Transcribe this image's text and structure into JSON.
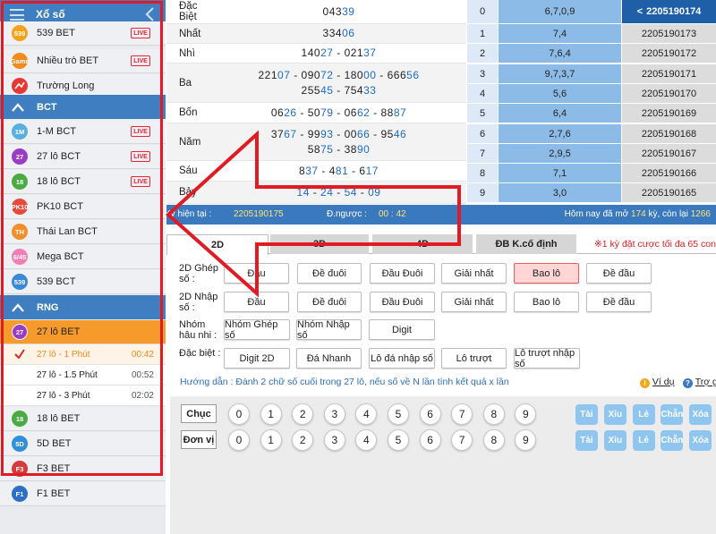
{
  "sidebar": {
    "title": "Xổ số",
    "rows_top": [
      {
        "label": "539 BET",
        "badge": "539",
        "color": "#f4a21a",
        "live": "LIVE"
      },
      {
        "label": "Nhiều trò BET",
        "badge": "Game",
        "color": "#f08a1c",
        "live": "LIVE"
      },
      {
        "label": "Trường Long",
        "badge": "",
        "color": "#e63935",
        "live": ""
      }
    ],
    "section_bct": "BCT",
    "rows_bct": [
      {
        "label": "1-M BCT",
        "badge": "1M",
        "color": "#59b0df",
        "live": "LIVE"
      },
      {
        "label": "27 lô BCT",
        "badge": "27",
        "color": "#9b3cc4",
        "live": "LIVE"
      },
      {
        "label": "18 lô BCT",
        "badge": "18",
        "color": "#4caa43",
        "live": "LIVE"
      },
      {
        "label": "PK10 BCT",
        "badge": "PK10",
        "color": "#e64a3b",
        "live": ""
      },
      {
        "label": "Thái Lan BCT",
        "badge": "TH",
        "color": "#f28e2b",
        "live": ""
      },
      {
        "label": "Mega BCT",
        "badge": "6/45",
        "color": "#ef7fb4",
        "live": ""
      },
      {
        "label": "539 BCT",
        "badge": "539",
        "color": "#3b87d8",
        "live": ""
      }
    ],
    "section_rng": "RNG",
    "active": {
      "label": "27 lô BET",
      "badge": "27",
      "color": "#9b3cc4"
    },
    "subs": [
      {
        "label": "27 lô - 1 Phút",
        "time": "00:42",
        "selected": true
      },
      {
        "label": "27 lô - 1.5 Phút",
        "time": "00:52",
        "selected": false
      },
      {
        "label": "27 lô - 3 Phút",
        "time": "02:02",
        "selected": false
      }
    ],
    "rows_rng": [
      {
        "label": "18 lô BET",
        "badge": "18",
        "color": "#4caa43"
      },
      {
        "label": "5D BET",
        "badge": "5D",
        "color": "#2f8fd8"
      },
      {
        "label": "F3 BET",
        "badge": "F3",
        "color": "#d63b3b"
      },
      {
        "label": "F1 BET",
        "badge": "F1",
        "color": "#2c6fc7"
      }
    ]
  },
  "results": [
    {
      "label": "Đặc Biệt",
      "lines": [
        [
          [
            "043",
            ""
          ],
          [
            "39",
            "b"
          ]
        ]
      ]
    },
    {
      "label": "Nhất",
      "lines": [
        [
          [
            "334",
            ""
          ],
          [
            "06",
            "b"
          ]
        ]
      ]
    },
    {
      "label": "Nhì",
      "lines": [
        [
          [
            "140",
            ""
          ],
          [
            "27",
            "b"
          ],
          [
            " - 021",
            ""
          ],
          [
            "37",
            "b"
          ]
        ]
      ]
    },
    {
      "label": "Ba",
      "lines": [
        [
          [
            "221",
            ""
          ],
          [
            "07",
            "b"
          ],
          [
            " - 090",
            ""
          ],
          [
            "72",
            "b"
          ],
          [
            " - 180",
            ""
          ],
          [
            "00",
            "b"
          ],
          [
            " - 666",
            ""
          ],
          [
            "56",
            "b"
          ]
        ],
        [
          [
            "255",
            ""
          ],
          [
            "45",
            "b"
          ],
          [
            " - 754",
            ""
          ],
          [
            "33",
            "b"
          ]
        ]
      ]
    },
    {
      "label": "Bốn",
      "lines": [
        [
          [
            "06",
            ""
          ],
          [
            "26",
            "b"
          ],
          [
            " - 50",
            ""
          ],
          [
            "79",
            "b"
          ],
          [
            " - 06",
            ""
          ],
          [
            "62",
            "b"
          ],
          [
            " - 88",
            ""
          ],
          [
            "87",
            "b"
          ]
        ]
      ]
    },
    {
      "label": "Năm",
      "lines": [
        [
          [
            "37",
            ""
          ],
          [
            "67",
            "b"
          ],
          [
            " - 99",
            ""
          ],
          [
            "93",
            "b"
          ],
          [
            " - 00",
            ""
          ],
          [
            "66",
            "b"
          ],
          [
            " - 95",
            ""
          ],
          [
            "46",
            "b"
          ]
        ],
        [
          [
            "58",
            ""
          ],
          [
            "75",
            "b"
          ],
          [
            " - 38",
            ""
          ],
          [
            "90",
            "b"
          ]
        ]
      ]
    },
    {
      "label": "Sáu",
      "lines": [
        [
          [
            "8",
            ""
          ],
          [
            "37",
            "b"
          ],
          [
            " - 4",
            ""
          ],
          [
            "81",
            "b"
          ],
          [
            " - 6",
            ""
          ],
          [
            "17",
            "b"
          ]
        ]
      ]
    },
    {
      "label": "Bảy",
      "lines": [
        [
          [
            "14",
            "b"
          ],
          [
            " - ",
            ""
          ],
          [
            "24",
            "b"
          ],
          [
            " - ",
            ""
          ],
          [
            "54",
            "b"
          ],
          [
            " - ",
            ""
          ],
          [
            "09",
            "b"
          ]
        ]
      ]
    }
  ],
  "stats": [
    {
      "n": "0",
      "v": "6,7,0,9",
      "id": "2205190174",
      "current": true
    },
    {
      "n": "1",
      "v": "7,4",
      "id": "2205190173",
      "current": false
    },
    {
      "n": "2",
      "v": "7,6,4",
      "id": "2205190172",
      "current": false
    },
    {
      "n": "3",
      "v": "9,7,3,7",
      "id": "2205190171",
      "current": false
    },
    {
      "n": "4",
      "v": "5,6",
      "id": "2205190170",
      "current": false
    },
    {
      "n": "5",
      "v": "6,4",
      "id": "2205190169",
      "current": false
    },
    {
      "n": "6",
      "v": "2,7,6",
      "id": "2205190168",
      "current": false
    },
    {
      "n": "7",
      "v": "2,9,5",
      "id": "2205190167",
      "current": false
    },
    {
      "n": "8",
      "v": "7,1",
      "id": "2205190166",
      "current": false
    },
    {
      "n": "9",
      "v": "3,0",
      "id": "2205190165",
      "current": false
    }
  ],
  "stats_prev": "<",
  "info": {
    "current_label": "Kỳ hiện tại :",
    "current_value": "2205190175",
    "countdown_label": "Đ.ngược :",
    "countdown_value": "00 : 42",
    "opened_prefix": "Hôm nay đã mở",
    "opened_count": "174",
    "opened_mid": "kỳ, còn lại",
    "remaining": "1266"
  },
  "tabs": [
    "2D",
    "3D",
    "4D",
    "ĐB K.cố định"
  ],
  "bet_note": "※1 kỳ đặt cược tối đa 65 con",
  "groups": [
    {
      "label": "2D Ghép số :",
      "buttons": [
        "Đầu",
        "Đề đuôi",
        "Đầu Đuôi",
        "Giải nhất",
        "Bao lô",
        "Đề đầu"
      ]
    },
    {
      "label": "2D Nhập số :",
      "buttons": [
        "Đầu",
        "Đề đuôi",
        "Đầu Đuôi",
        "Giải nhất",
        "Bao lô",
        "Đề đầu"
      ]
    },
    {
      "label": "Nhóm hâu nhi :",
      "buttons": [
        "Nhóm Ghép số",
        "Nhóm Nhập số",
        "Digit"
      ]
    },
    {
      "label": "Đặc biệt :",
      "buttons": [
        "Digit 2D",
        "Đá Nhanh",
        "Lô đá nhập số",
        "Lô trượt",
        "Lô trượt nhập số"
      ]
    }
  ],
  "guide": "Hướng dẫn : Đánh 2 chữ số cuối trong 27 lô, nếu số về N lần tính kết quả x lần",
  "example_link": "Ví dụ",
  "help_link": "Trợ giúp",
  "digits": [
    "0",
    "1",
    "2",
    "3",
    "4",
    "5",
    "6",
    "7",
    "8",
    "9"
  ],
  "row_labels": [
    "Chục",
    "Đơn vị"
  ],
  "quick": [
    "Tài",
    "Xỉu",
    "Lẻ",
    "Chẵn",
    "Xóa"
  ],
  "colors": {
    "accent": "#3f7fc1",
    "highlight_red": "#e01b24",
    "link_blue": "#1c6cc8",
    "active_orange": "#f79a2c"
  }
}
